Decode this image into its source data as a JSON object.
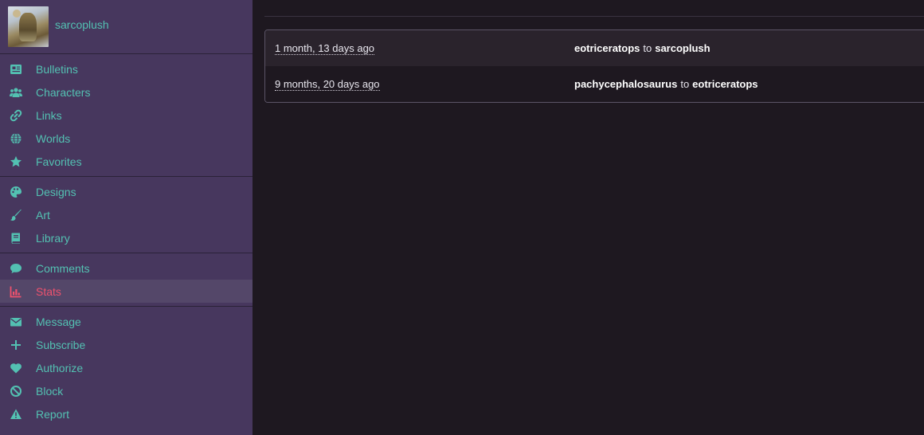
{
  "profile": {
    "username": "sarcoplush"
  },
  "sidebar": {
    "groups": [
      {
        "items": [
          {
            "label": "Bulletins",
            "icon": "newspaper-icon"
          },
          {
            "label": "Characters",
            "icon": "users-icon"
          },
          {
            "label": "Links",
            "icon": "link-icon"
          },
          {
            "label": "Worlds",
            "icon": "globe-icon"
          },
          {
            "label": "Favorites",
            "icon": "star-icon"
          }
        ]
      },
      {
        "items": [
          {
            "label": "Designs",
            "icon": "palette-icon"
          },
          {
            "label": "Art",
            "icon": "paintbrush-icon"
          },
          {
            "label": "Library",
            "icon": "book-icon"
          }
        ]
      },
      {
        "items": [
          {
            "label": "Comments",
            "icon": "comment-icon"
          },
          {
            "label": "Stats",
            "icon": "chart-icon",
            "active": true
          }
        ]
      },
      {
        "items": [
          {
            "label": "Message",
            "icon": "envelope-icon"
          },
          {
            "label": "Subscribe",
            "icon": "plus-icon"
          },
          {
            "label": "Authorize",
            "icon": "heart-icon"
          },
          {
            "label": "Block",
            "icon": "ban-icon"
          },
          {
            "label": "Report",
            "icon": "warning-icon"
          }
        ]
      }
    ]
  },
  "history": {
    "rows": [
      {
        "date": "1 month, 13 days ago",
        "from": "eotriceratops",
        "connector": "to",
        "to": "sarcoplush"
      },
      {
        "date": "9 months, 20 days ago",
        "from": "pachycephalosaurus",
        "connector": "to",
        "to": "eotriceratops"
      }
    ]
  },
  "colors": {
    "sidebar_bg": "#47375e",
    "accent": "#53c1b2",
    "active": "#f0526e",
    "main_bg": "#1e1820"
  }
}
